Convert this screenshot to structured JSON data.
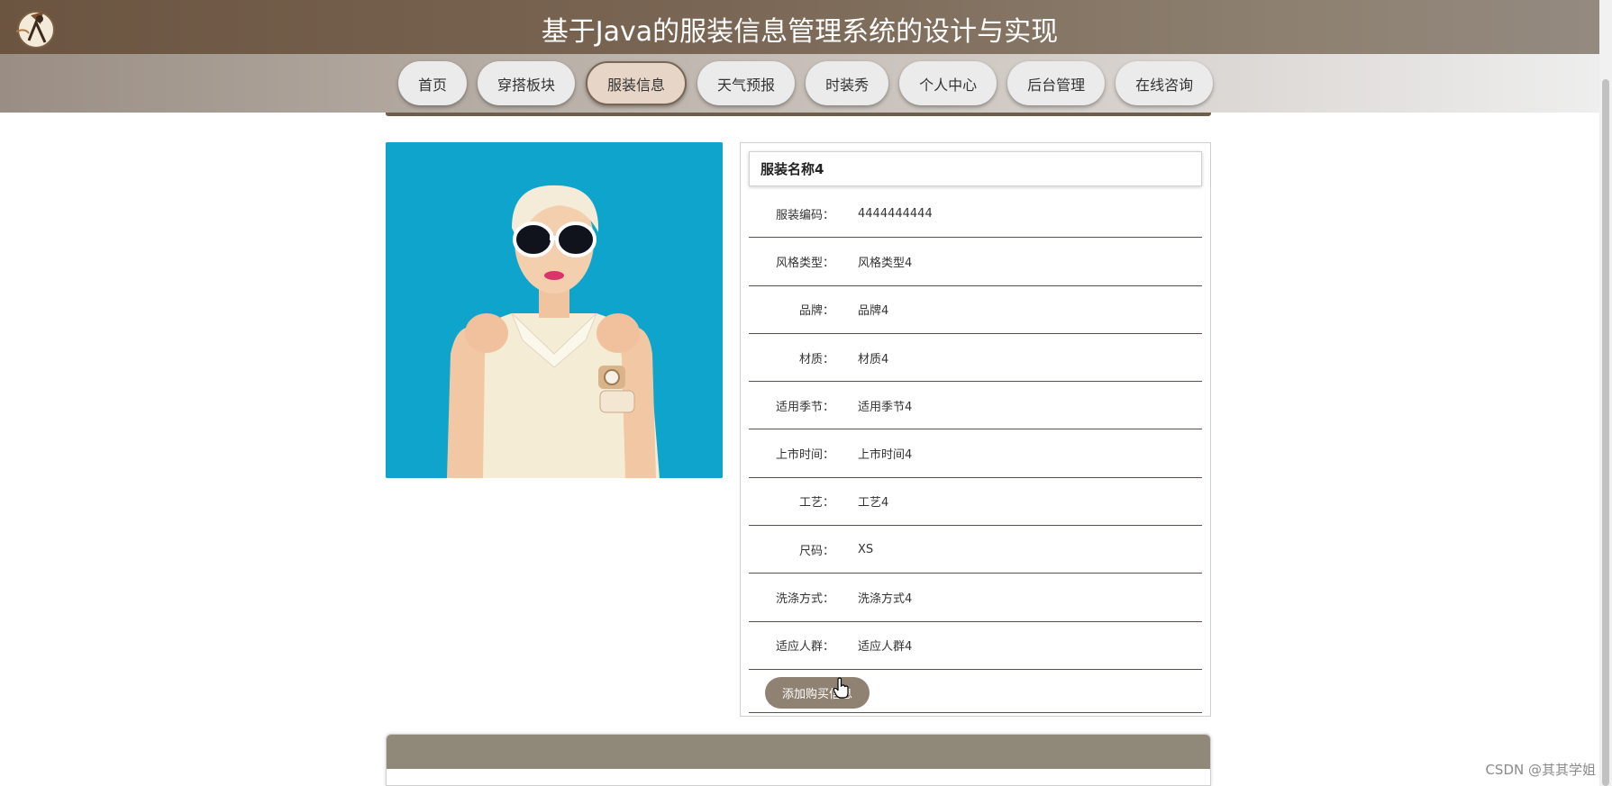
{
  "site": {
    "title": "基于Java的服装信息管理系统的设计与实现"
  },
  "nav": {
    "items": [
      {
        "label": "首页"
      },
      {
        "label": "穿搭板块"
      },
      {
        "label": "服装信息",
        "active": true
      },
      {
        "label": "天气预报"
      },
      {
        "label": "时装秀"
      },
      {
        "label": "个人中心"
      },
      {
        "label": "后台管理"
      },
      {
        "label": "在线咨询"
      }
    ]
  },
  "product": {
    "name": "服装名称4",
    "fields": [
      {
        "label": "服装编码：",
        "value": "4444444444"
      },
      {
        "label": "风格类型：",
        "value": "风格类型4"
      },
      {
        "label": "品牌：",
        "value": "品牌4"
      },
      {
        "label": "材质：",
        "value": "材质4"
      },
      {
        "label": "适用季节：",
        "value": "适用季节4"
      },
      {
        "label": "上市时间：",
        "value": "上市时间4"
      },
      {
        "label": "工艺：",
        "value": "工艺4"
      },
      {
        "label": "尺码：",
        "value": "XS"
      },
      {
        "label": "洗涤方式：",
        "value": "洗涤方式4"
      },
      {
        "label": "适应人群：",
        "value": "适应人群4"
      }
    ],
    "buy_button": "添加购买信息"
  },
  "watermark": "CSDN @其其学姐",
  "colors": {
    "header_dark": "#6b5541",
    "active_nav": "#e7d5c8",
    "button": "#8f8272",
    "photo_bg": "#0ea0c8"
  }
}
